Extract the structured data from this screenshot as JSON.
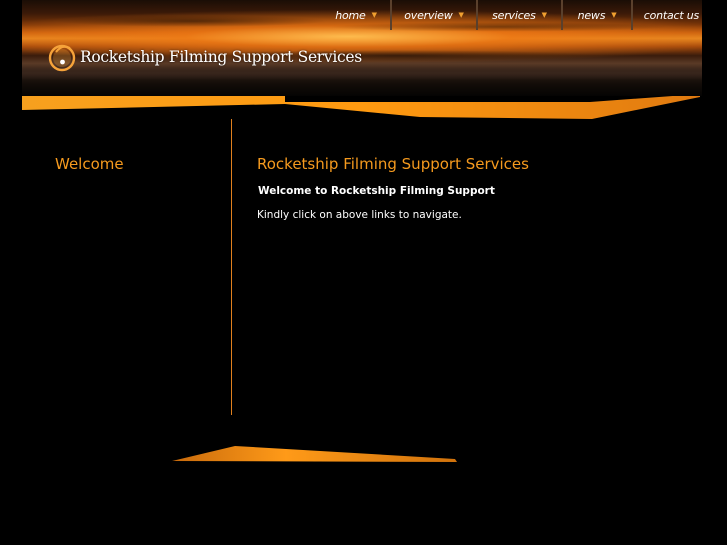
{
  "nav": {
    "items": [
      {
        "label": "home",
        "arrow": "▼"
      },
      {
        "label": "overview",
        "arrow": "▼"
      },
      {
        "label": "services",
        "arrow": "▼"
      },
      {
        "label": "news",
        "arrow": "▼"
      },
      {
        "label": "contact us",
        "arrow": "▼"
      }
    ]
  },
  "logo": {
    "text": "Rocketship Filming Support Services",
    "icon": "rocketship-logo-icon"
  },
  "sidebar": {
    "title": "Welcome"
  },
  "main": {
    "title": "Rocketship Filming Support Services",
    "subtitle": "Welcome to Rocketship Filming Support",
    "body": "Kindly click on above links to navigate."
  },
  "colors": {
    "accent": "#f59a1e",
    "background": "#000000",
    "text": "#ffffff"
  }
}
